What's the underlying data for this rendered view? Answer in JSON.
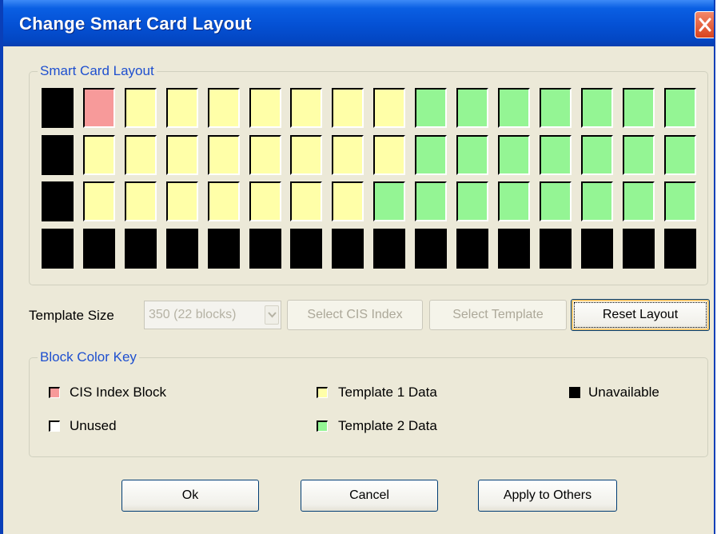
{
  "window": {
    "title": "Change Smart Card Layout"
  },
  "layout_group": {
    "legend": "Smart Card Layout",
    "rows": [
      [
        "U",
        "C",
        "Y",
        "Y",
        "Y",
        "Y",
        "Y",
        "Y",
        "Y",
        "G",
        "G",
        "G",
        "G",
        "G",
        "G",
        "G"
      ],
      [
        "U",
        "Y",
        "Y",
        "Y",
        "Y",
        "Y",
        "Y",
        "Y",
        "Y",
        "G",
        "G",
        "G",
        "G",
        "G",
        "G",
        "G"
      ],
      [
        "U",
        "Y",
        "Y",
        "Y",
        "Y",
        "Y",
        "Y",
        "Y",
        "G",
        "G",
        "G",
        "G",
        "G",
        "G",
        "G",
        "G"
      ],
      [
        "U",
        "U",
        "U",
        "U",
        "U",
        "U",
        "U",
        "U",
        "U",
        "U",
        "U",
        "U",
        "U",
        "U",
        "U",
        "U"
      ]
    ]
  },
  "colors": {
    "cis_index": "#f79a9a",
    "template1": "#ffffa8",
    "template2": "#94f594",
    "unavailable": "#000000",
    "unused": "#ffffff"
  },
  "controls": {
    "template_size_label": "Template Size",
    "template_size_value": "350 (22 blocks)",
    "select_cis_label": "Select CIS Index",
    "select_template_label": "Select Template",
    "reset_layout_label": "Reset Layout"
  },
  "key_group": {
    "legend": "Block Color Key",
    "cis_index": "CIS Index Block",
    "template1": "Template 1 Data",
    "unavailable": "Unavailable",
    "unused": "Unused",
    "template2": "Template 2 Data"
  },
  "footer": {
    "ok_label": "Ok",
    "cancel_label": "Cancel",
    "apply_label": "Apply to Others"
  }
}
